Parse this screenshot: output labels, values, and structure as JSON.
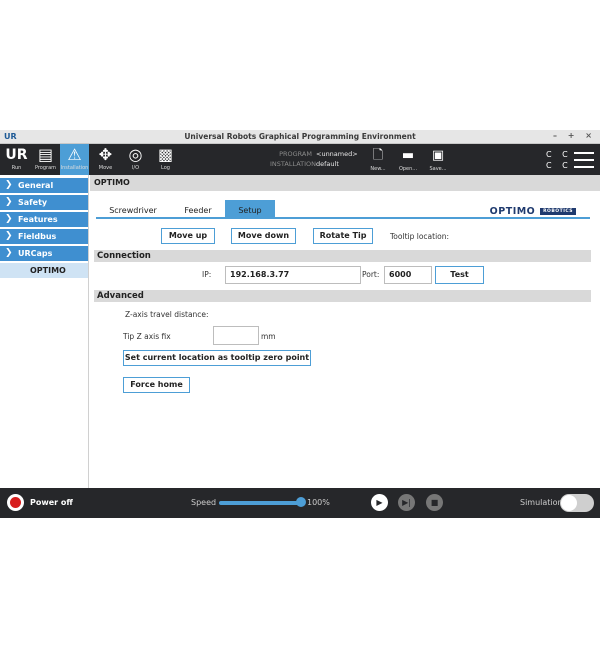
{
  "window": {
    "logo": "UR",
    "title": "Universal Robots Graphical Programming Environment",
    "controls": "– + ×"
  },
  "toolbar": {
    "buttons": [
      {
        "label": "Run",
        "icon": "ur-logo-icon"
      },
      {
        "label": "Program",
        "icon": "program-icon"
      },
      {
        "label": "Installation",
        "icon": "installation-icon"
      },
      {
        "label": "Move",
        "icon": "move-icon"
      },
      {
        "label": "I/O",
        "icon": "io-icon"
      },
      {
        "label": "Log",
        "icon": "log-icon"
      }
    ],
    "program_label": "PROGRAM",
    "program_value": "<unnamed>",
    "installation_label": "INSTALLATION",
    "installation_value": "default",
    "file_buttons": [
      {
        "label": "New...",
        "icon": "new-file-icon"
      },
      {
        "label": "Open...",
        "icon": "open-folder-icon"
      },
      {
        "label": "Save...",
        "icon": "save-icon"
      }
    ],
    "cc_top": "C C",
    "cc_bottom": "C C"
  },
  "sidebar": {
    "items": [
      {
        "label": "General"
      },
      {
        "label": "Safety"
      },
      {
        "label": "Features"
      },
      {
        "label": "Fieldbus"
      },
      {
        "label": "URCaps"
      }
    ],
    "subitem": "OPTIMO"
  },
  "main": {
    "header": "OPTIMO",
    "tabs": [
      "Screwdriver",
      "Feeder",
      "Setup"
    ],
    "active_tab": "Setup",
    "logo_text": "OPTIMO",
    "logo_badge": "ROBOTICS",
    "buttons": {
      "move_up": "Move up",
      "move_down": "Move down",
      "rotate_tip": "Rotate Tip"
    },
    "tooltip_location_label": "Tooltip location:",
    "connection": {
      "title": "Connection",
      "ip_label": "IP:",
      "ip_value": "192.168.3.77",
      "port_label": "Port:",
      "port_value": "6000",
      "test_label": "Test"
    },
    "advanced": {
      "title": "Advanced",
      "z_travel_label": "Z-axis travel distance:",
      "tip_z_label": "Tip Z axis fix",
      "tip_z_value": "",
      "tip_z_unit": "mm",
      "set_zero_label": "Set current location as tooltip zero point",
      "force_home_label": "Force home"
    }
  },
  "bottom": {
    "power_label": "Power off",
    "speed_label": "Speed",
    "speed_value": "100%",
    "speed_fraction": 1.0,
    "simulation_label": "Simulation",
    "simulation_on": false
  },
  "colors": {
    "accent": "#4d9ed6",
    "toolbar_bg": "#26272a",
    "sidebar_item": "#3f8fd0",
    "power_red": "#d71d1d"
  }
}
